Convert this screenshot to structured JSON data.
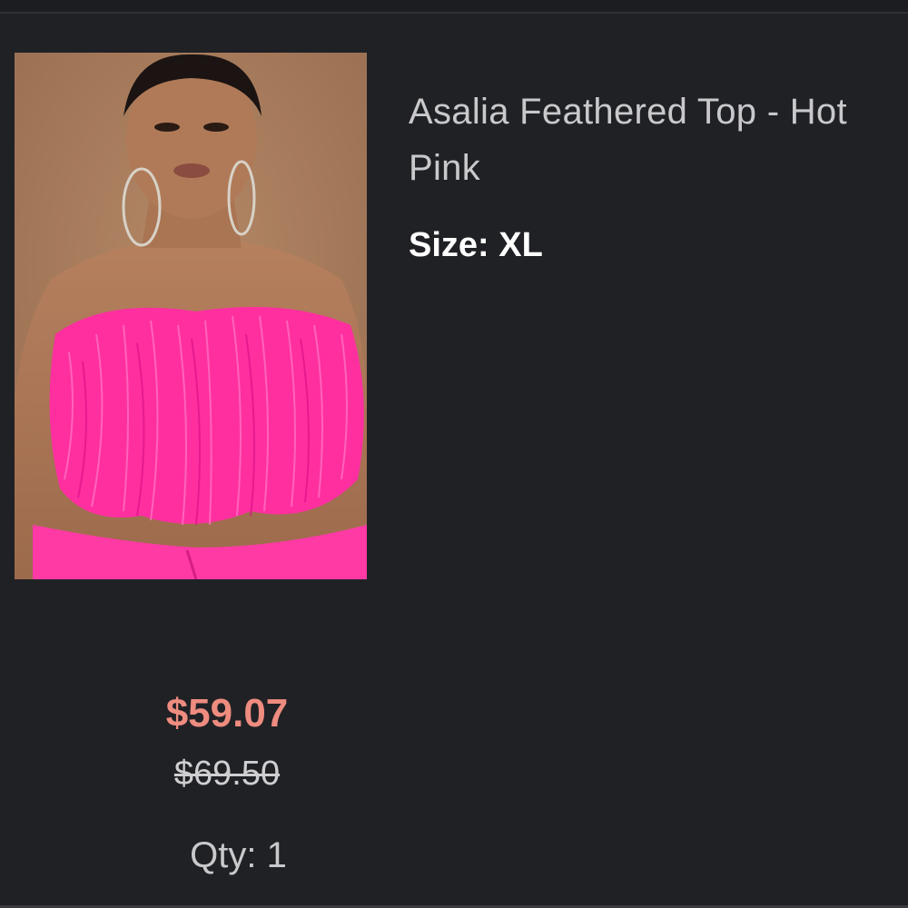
{
  "product": {
    "name": "Asalia Feathered Top - Hot Pink",
    "size_label": "Size:",
    "size_value": "XL",
    "sale_price": "$59.07",
    "original_price": "$69.50",
    "qty_label": "Qty:",
    "qty_value": "1"
  },
  "colors": {
    "background": "#202125",
    "sale_price": "#ee8c7f",
    "product_pink": "#ff2fa0"
  }
}
